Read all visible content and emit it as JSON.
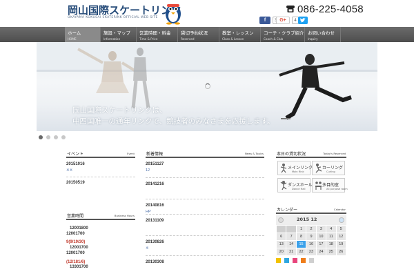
{
  "header": {
    "logo_title": "岡山国際スケートリンク",
    "logo_sub": "OKAYAMA KOKUSAI SKATERINK OFFICIAL WEB SITE",
    "phone": "086-225-4058",
    "fb_count": "376",
    "gplus_label": "G+",
    "gplus_count": "4"
  },
  "nav": [
    {
      "jp": "ホーム",
      "en": "HOME"
    },
    {
      "jp": "施設・マップ",
      "en": "Information"
    },
    {
      "jp": "営業時間・料金",
      "en": "Time & Price"
    },
    {
      "jp": "貸切予約状況",
      "en": "Reserved"
    },
    {
      "jp": "教室・レッスン",
      "en": "Class & Lesson"
    },
    {
      "jp": "コーチ・クラブ紹介",
      "en": "Coach & Club"
    },
    {
      "jp": "お問い合わせ",
      "en": "Inquiry"
    }
  ],
  "hero": {
    "caption_line1": "岡山国際スケートリンクは、",
    "caption_line2": "中四国唯一の通年リンクで、競技者のみなさまを応援します。"
  },
  "event": {
    "title": "イベント",
    "title_en": "Event",
    "items": [
      {
        "date": "20151016",
        "link": "※※"
      },
      {
        "date": "20150519",
        "link": ""
      }
    ]
  },
  "hours": {
    "title": "営業時間",
    "title_en": "Business Hours",
    "lines": [
      "12001800",
      "12001700",
      "9(9/19/30)",
      "12001700",
      "12001700",
      "(12/181/6)",
      "13301700"
    ]
  },
  "news": {
    "title": "新着情報",
    "title_en": "News & Topics",
    "items": [
      {
        "date": "20151127",
        "link": "12"
      },
      {
        "date": "20141216",
        "link": ""
      },
      {
        "date": "20140816",
        "link": "HP"
      },
      {
        "date": "20131109",
        "link": ""
      },
      {
        "date": "20130826",
        "link": "※"
      },
      {
        "date": "20130308",
        "link": ""
      }
    ]
  },
  "status": {
    "title": "本日の貸切状況",
    "title_en": "Today's Reserved",
    "rinks": [
      {
        "jp": "メインリンク",
        "en": "Main Rink"
      },
      {
        "jp": "カーリング",
        "en": "Curling"
      },
      {
        "jp": "ダンスホール",
        "en": "Dance Hall"
      },
      {
        "jp": "多目的室",
        "en": "All purpose room"
      }
    ]
  },
  "calendar": {
    "title": "カレンダー",
    "title_en": "Calendar",
    "month_label": "2015 12",
    "rows": [
      [
        "",
        "",
        "1",
        "2",
        "3",
        "4",
        "5"
      ],
      [
        "6",
        "7",
        "8",
        "9",
        "10",
        "11",
        "12"
      ],
      [
        "13",
        "14",
        "15",
        "16",
        "17",
        "18",
        "19"
      ],
      [
        "20",
        "21",
        "22",
        "23",
        "24",
        "25",
        "26"
      ]
    ],
    "today": "15",
    "legend_colors": [
      "#f2c200",
      "#2ea7e0",
      "#e8457c",
      "#ef7d1a",
      "#cfcfcf"
    ]
  }
}
